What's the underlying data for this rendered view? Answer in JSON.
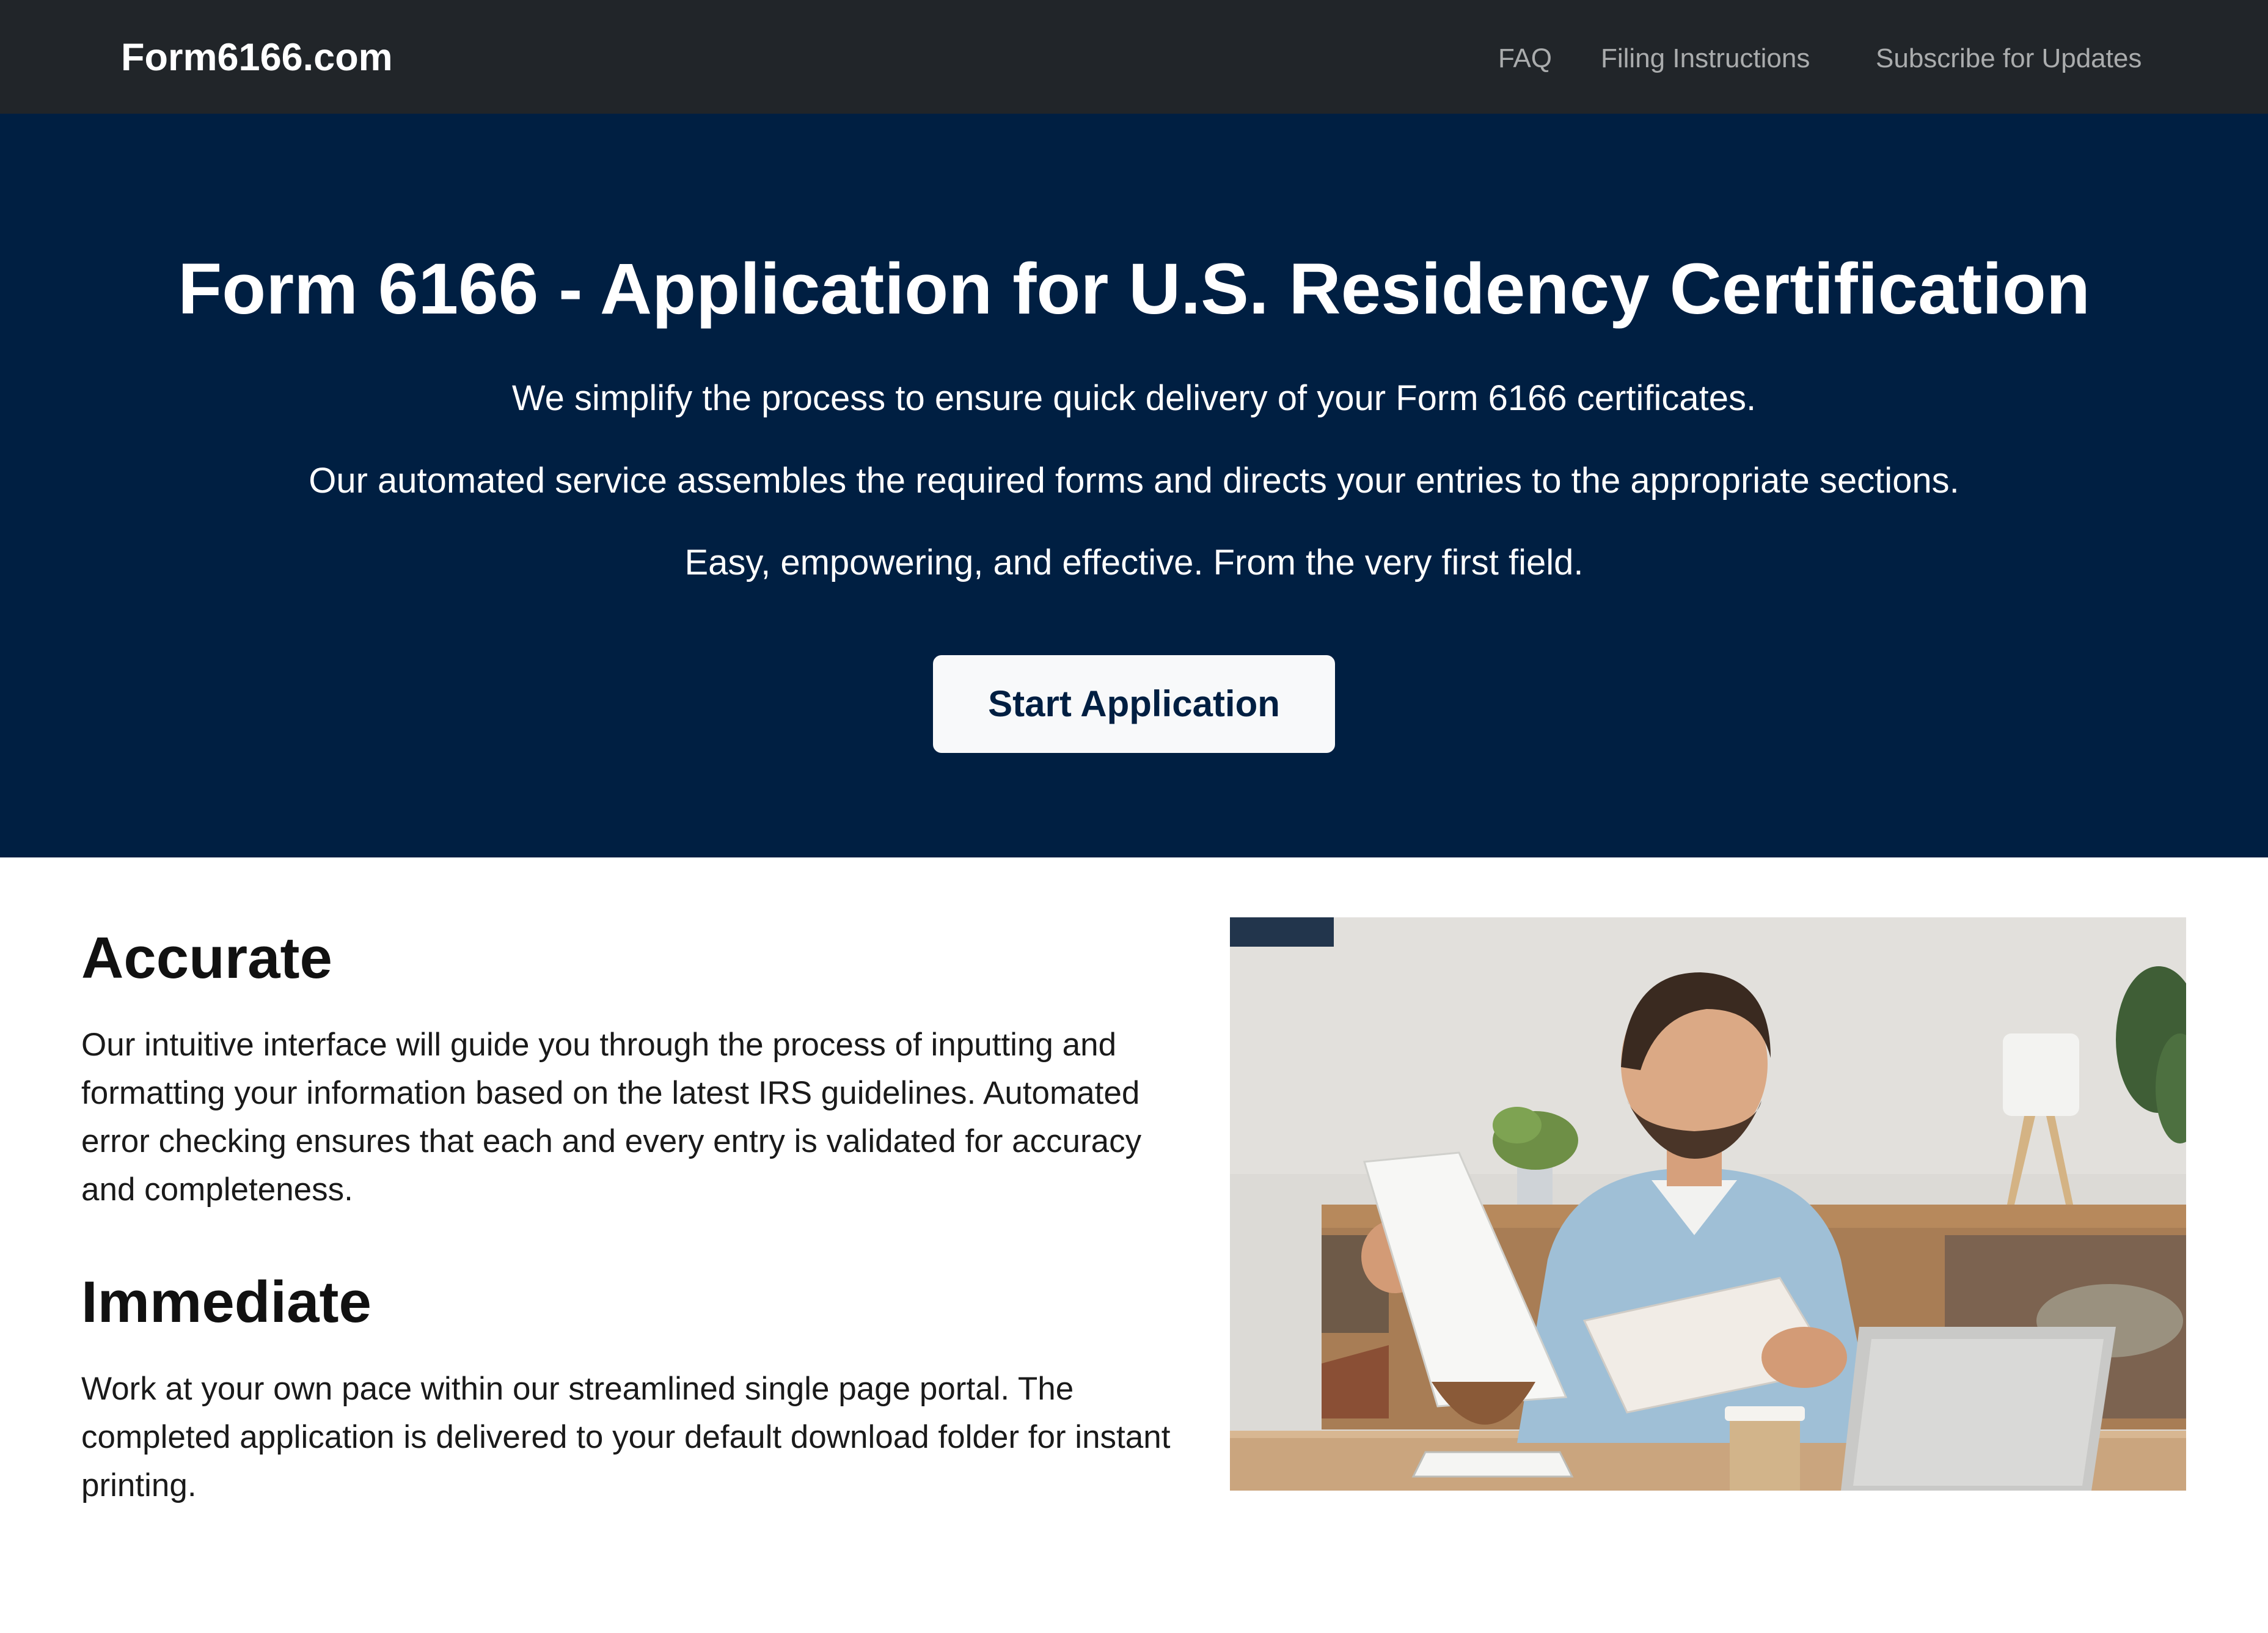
{
  "navbar": {
    "brand": "Form6166.com",
    "links": [
      {
        "label": "FAQ"
      },
      {
        "label": "Filing Instructions"
      },
      {
        "label": "Subscribe for Updates"
      }
    ]
  },
  "hero": {
    "title": "Form 6166 - Application for U.S. Residency Certification",
    "lines": [
      "We simplify the process to ensure quick delivery of your Form 6166 certificates.",
      "Our automated service assembles the required forms and directs your entries to the appropriate sections.",
      "Easy, empowering, and effective. From the very first field."
    ],
    "cta_label": "Start Application"
  },
  "features": [
    {
      "heading": "Accurate",
      "text": "Our intuitive interface will guide you through the process of inputting and formatting your information based on the latest IRS guidelines. Automated error checking ensures that each and every entry is validated for accuracy and completeness."
    },
    {
      "heading": "Immediate",
      "text": "Work at your own pace within our streamlined single page portal. The completed application is delivered to your default download folder for instant printing."
    }
  ],
  "photo": {
    "subject": "man-reviewing-documents-photo"
  },
  "colors": {
    "navbar_bg": "#212529",
    "hero_bg": "#001f42",
    "button_bg": "#f8f9fa",
    "button_text": "#001f42"
  }
}
